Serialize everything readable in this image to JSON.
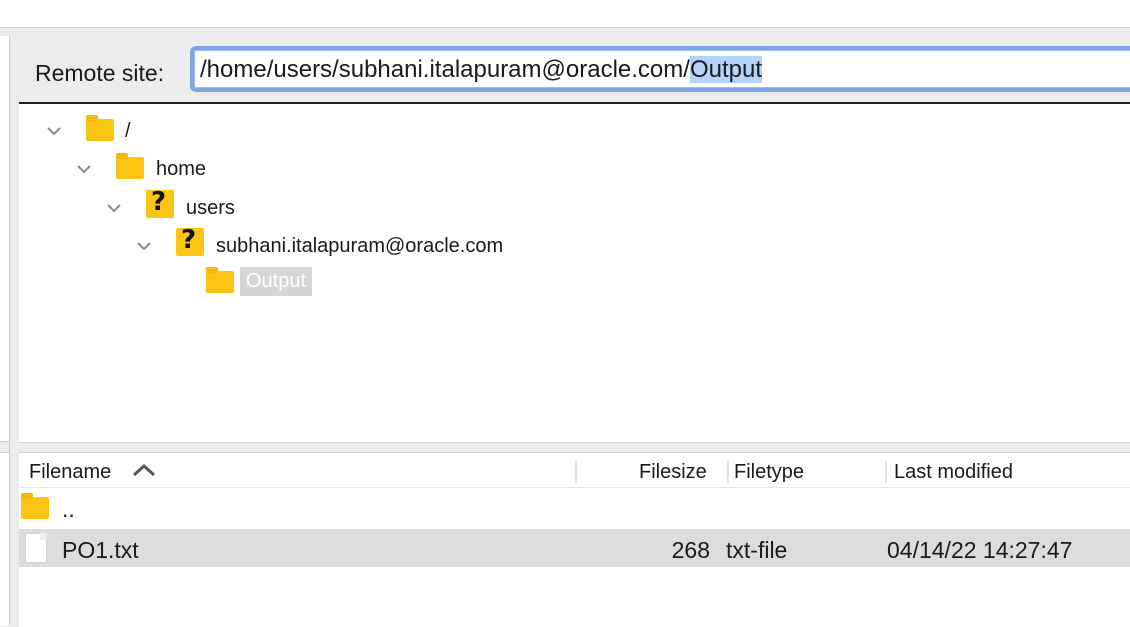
{
  "remote_site": {
    "label": "Remote site:",
    "path_prefix": "/home/users/subhani.italapuram@oracle.com/",
    "path_selected": "Output"
  },
  "tree": {
    "nodes": [
      {
        "label": "/",
        "icon": "folder-icon",
        "expanded": true
      },
      {
        "label": "home",
        "icon": "folder-icon",
        "expanded": true
      },
      {
        "label": "users",
        "icon": "unknown-folder-icon",
        "expanded": true
      },
      {
        "label": "subhani.italapuram@oracle.com",
        "icon": "unknown-folder-icon",
        "expanded": true
      },
      {
        "label": "Output",
        "icon": "open-folder-icon",
        "selected": true
      }
    ]
  },
  "file_list": {
    "columns": {
      "filename": "Filename",
      "filesize": "Filesize",
      "filetype": "Filetype",
      "last_modified": "Last modified"
    },
    "sort": {
      "column": "Filename",
      "direction": "ascending"
    },
    "rows": [
      {
        "filename": "..",
        "icon": "folder-icon",
        "filesize": "",
        "filetype": "",
        "last_modified": ""
      },
      {
        "filename": "PO1.txt",
        "icon": "file-icon",
        "filesize": "268",
        "filetype": "txt-file",
        "last_modified": "04/14/22 14:27:47",
        "selected": true
      }
    ]
  },
  "colors": {
    "folder": "#fbc514",
    "focus_ring": "#7fa6e4",
    "text_selection": "#b4d3f8",
    "row_selected": "#dcdcdc"
  }
}
